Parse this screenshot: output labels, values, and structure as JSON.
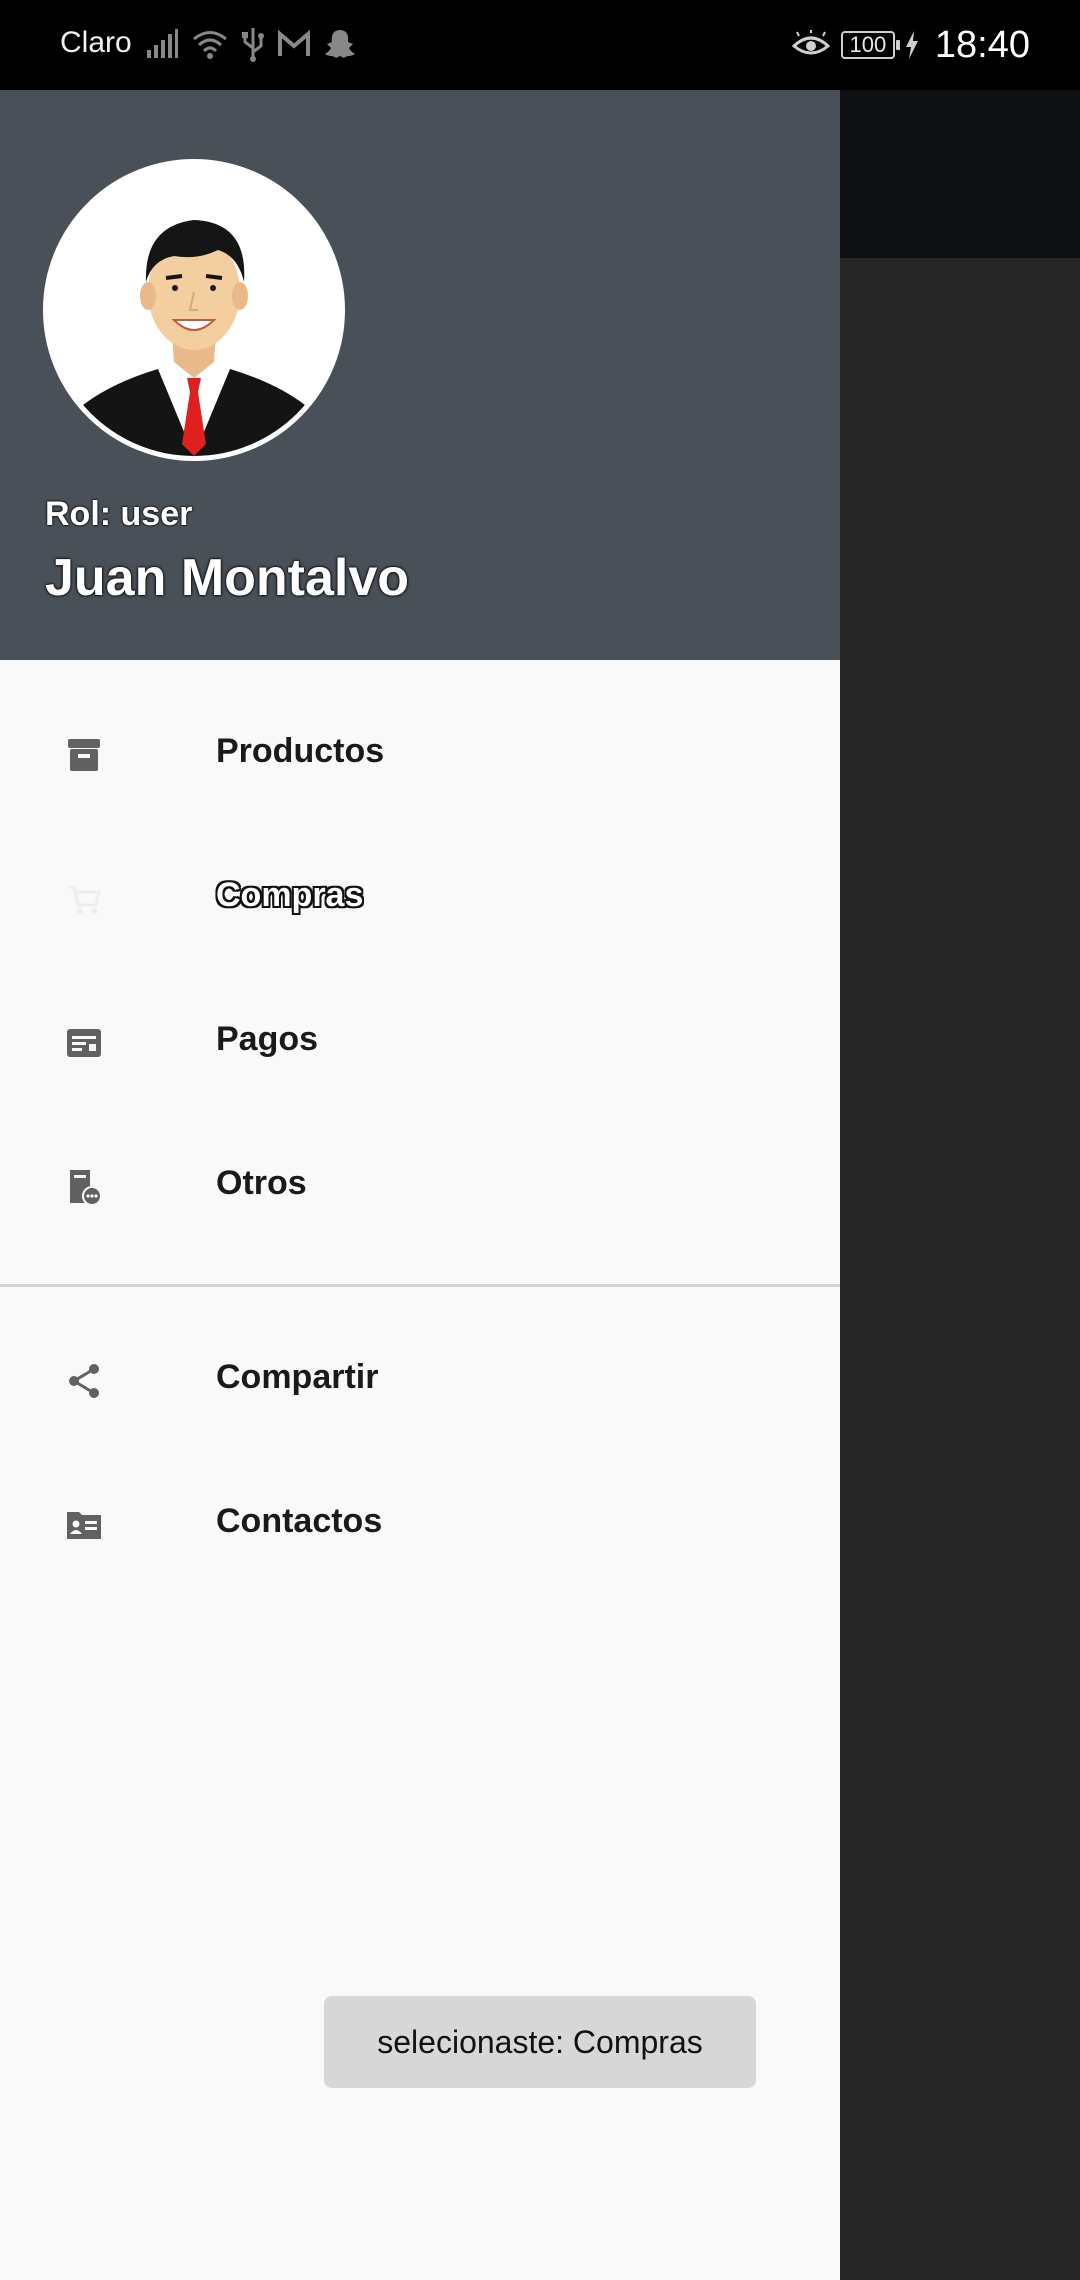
{
  "status_bar": {
    "carrier": "Claro",
    "battery": "100",
    "time": "18:40"
  },
  "drawer": {
    "header": {
      "role": "Rol: user",
      "name": "Juan Montalvo",
      "header_color": "#495058"
    },
    "items": [
      {
        "label": "Productos",
        "icon": "archive-box-icon"
      },
      {
        "label": "Compras",
        "icon": "shopping-cart-icon"
      },
      {
        "label": "Pagos",
        "icon": "receipt-icon"
      },
      {
        "label": "Otros",
        "icon": "document-chat-icon"
      }
    ],
    "secondary_items": [
      {
        "label": "Compartir",
        "icon": "share-icon"
      },
      {
        "label": "Contactos",
        "icon": "contacts-folder-icon"
      }
    ]
  },
  "toast": {
    "message": "selecionaste: Compras"
  }
}
